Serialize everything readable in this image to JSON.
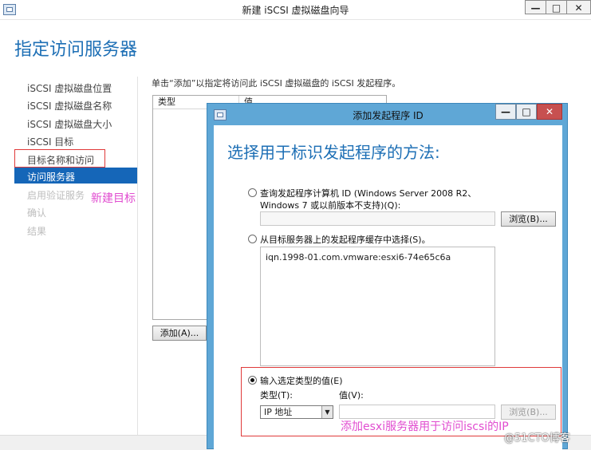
{
  "main_window": {
    "title": "新建 iSCSI 虚拟磁盘向导",
    "controls": {
      "minimize": "—",
      "maximize": "□",
      "close": "✕"
    }
  },
  "wizard": {
    "heading": "指定访问服务器",
    "nav": [
      {
        "label": "iSCSI 虚拟磁盘位置"
      },
      {
        "label": "iSCSI 虚拟磁盘名称"
      },
      {
        "label": "iSCSI 虚拟磁盘大小"
      },
      {
        "label": "iSCSI 目标"
      },
      {
        "label": "目标名称和访问"
      },
      {
        "label": "访问服务器"
      },
      {
        "label": "启用验证服务"
      },
      {
        "label": "确认"
      },
      {
        "label": "结果"
      }
    ],
    "annotation": "新建目标",
    "instruction": "单击“添加”以指定将访问此 iSCSI 虚拟磁盘的 iSCSI 发起程序。",
    "list_headers": [
      "类型",
      "值"
    ],
    "add_button": "添加(A)..."
  },
  "dialog": {
    "title": "添加发起程序 ID",
    "controls": {
      "minimize": "—",
      "maximize": "□",
      "close": "✕"
    },
    "heading": "选择用于标识发起程序的方法:",
    "option1": {
      "line1": "查询发起程序计算机 ID (Windows Server 2008 R2、",
      "line2": "Windows 7 或以前版本不支持)(Q):",
      "selected": false,
      "browse": "浏览(B)..."
    },
    "option2": {
      "label": "从目标服务器上的发起程序缓存中选择(S)。",
      "selected": false,
      "entries": [
        "iqn.1998-01.com.vmware:esxi6-74e65c6a"
      ]
    },
    "option3": {
      "label": "输入选定类型的值(E)",
      "selected": true,
      "type_label": "类型(T):",
      "value_label": "值(V):",
      "type_value": "IP 地址",
      "value": "",
      "browse": "浏览(B)..."
    },
    "annotation": "添加esxi服务器用于访问iscsi的IP"
  },
  "watermark": "@51CTO博客",
  "colors": {
    "accent": "#1d6fb5",
    "selection": "#1566b8",
    "annotation_text": "#e14dd0",
    "highlight_border": "#e03a3a",
    "dialog_frame": "#5fa7d6"
  }
}
